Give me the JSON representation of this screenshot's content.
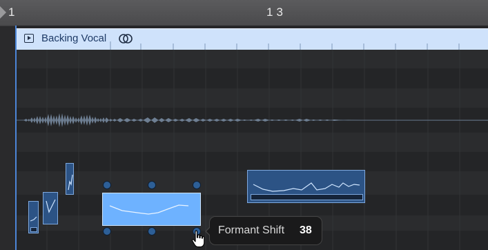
{
  "ruler": {
    "bar_left": "1",
    "bar_mid": "13"
  },
  "region": {
    "title": "Backing Vocal",
    "icon": "play-region-icon",
    "link_icon": "link-rings-icon"
  },
  "tooltip": {
    "label": "Formant Shift",
    "value": "38"
  },
  "colors": {
    "header_bg": "#cfe2fb",
    "header_text": "#1e3a66",
    "note_fill": "#2c5385",
    "note_selected": "#6eb2ff",
    "playhead": "#4c86d8"
  }
}
